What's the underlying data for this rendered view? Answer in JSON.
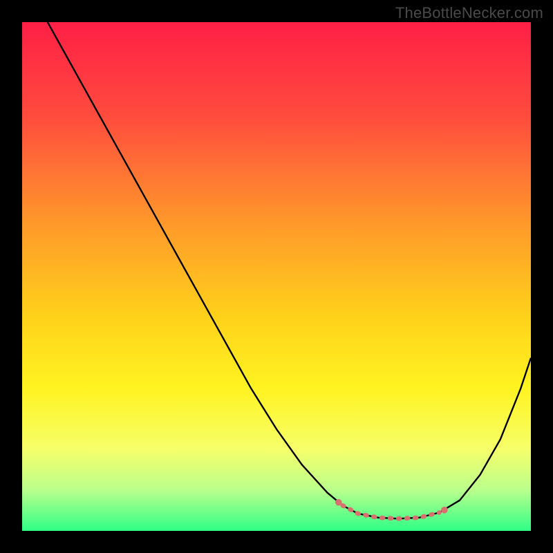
{
  "watermark": "TheBottleNecker.com",
  "chart_data": {
    "type": "line",
    "title": "",
    "xlabel": "",
    "ylabel": "",
    "xlim": [
      0,
      100
    ],
    "ylim": [
      0,
      100
    ],
    "gradient_stops": [
      {
        "offset": 0,
        "color": "#ff1f46"
      },
      {
        "offset": 18,
        "color": "#ff4a3e"
      },
      {
        "offset": 40,
        "color": "#ff9a2a"
      },
      {
        "offset": 58,
        "color": "#ffd21a"
      },
      {
        "offset": 72,
        "color": "#fff321"
      },
      {
        "offset": 84,
        "color": "#f6ff6a"
      },
      {
        "offset": 92,
        "color": "#b9ff8c"
      },
      {
        "offset": 100,
        "color": "#2fff86"
      }
    ],
    "series": [
      {
        "name": "curve",
        "stroke": "#000000",
        "stroke_width": 2.4,
        "x": [
          5,
          10,
          15,
          20,
          25,
          30,
          35,
          40,
          45,
          50,
          55,
          60,
          63,
          66,
          70,
          74,
          78,
          82,
          86,
          90,
          94,
          98,
          100
        ],
        "y": [
          100,
          91,
          82,
          73,
          64,
          55,
          46,
          37,
          28,
          20,
          13,
          7.5,
          5,
          3.4,
          2.6,
          2.4,
          2.6,
          3.6,
          6,
          11,
          18,
          28,
          34
        ]
      }
    ],
    "flat_segment": {
      "stroke": "#d87070",
      "stroke_width": 6.5,
      "linecap": "round",
      "x": [
        63,
        66,
        70,
        74,
        78,
        82
      ],
      "y": [
        5,
        3.4,
        2.6,
        2.4,
        2.6,
        3.6
      ]
    },
    "endpoint_dots": {
      "fill": "#d87070",
      "r": 4.8,
      "points": [
        {
          "x": 62.2,
          "y": 5.6
        },
        {
          "x": 83.0,
          "y": 4.1
        }
      ]
    }
  }
}
